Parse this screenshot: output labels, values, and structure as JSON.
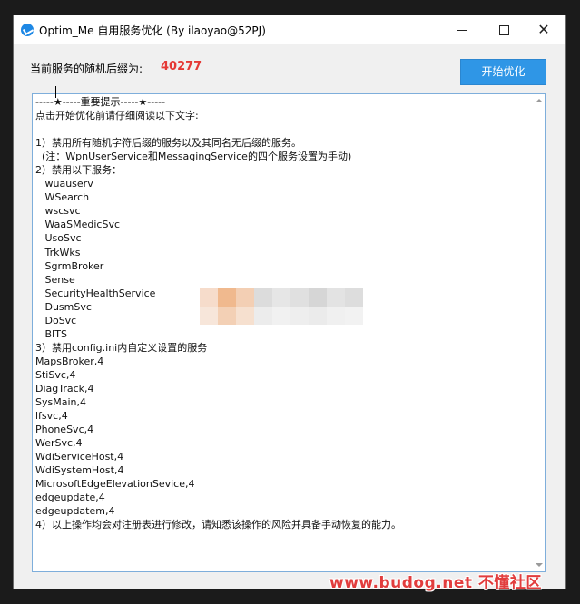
{
  "window": {
    "title": "Optim_Me 自用服务优化 (By ilaoyao@52PJ)",
    "icon": "app-logo-icon",
    "controls": {
      "minimize": "minimize-icon",
      "maximize": "maximize-icon",
      "close": "close-icon",
      "close_glyph": "✕"
    }
  },
  "service_suffix": {
    "label": "当前服务的随机后缀为:",
    "value": "40277",
    "value_color": "#e53935"
  },
  "start_button": {
    "label": "开始优化",
    "color": "#2f96e6"
  },
  "text_content": {
    "lines": [
      "-----★-----重要提示-----★-----",
      "点击开始优化前请仔细阅读以下文字:",
      "",
      "1）禁用所有随机字符后缀的服务以及其同名无后缀的服务。",
      "  (注：WpnUserService和MessagingService的四个服务设置为手动)",
      "2）禁用以下服务：",
      "   wuauserv",
      "   WSearch",
      "   wscsvc",
      "   WaaSMedicSvc",
      "   UsoSvc",
      "   TrkWks",
      "   SgrmBroker",
      "   Sense",
      "   SecurityHealthService",
      "   DusmSvc",
      "   DoSvc",
      "   BITS",
      "3）禁用config.ini内自定义设置的服务",
      "MapsBroker,4",
      "StiSvc,4",
      "DiagTrack,4",
      "SysMain,4",
      "lfsvc,4",
      "PhoneSvc,4",
      "WerSvc,4",
      "WdiServiceHost,4",
      "WdiSystemHost,4",
      "MicrosoftEdgeElevationSevice,4",
      "edgeupdate,4",
      "edgeupdatem,4",
      "4）以上操作均会对注册表进行修改，请知悉该操作的风险并具备手动恢复的能力。"
    ]
  },
  "watermark": {
    "text": "www.budog.net 不懂社区"
  }
}
